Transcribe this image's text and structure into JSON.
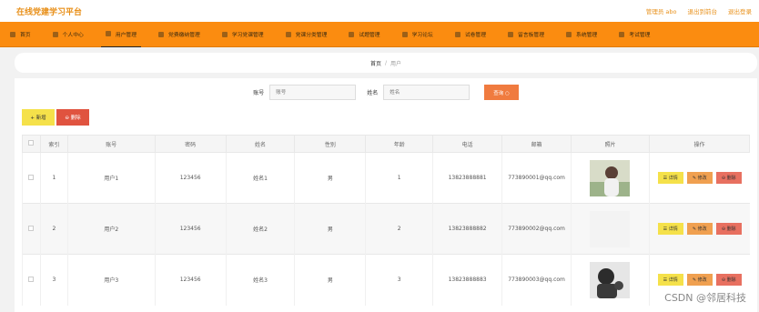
{
  "app": {
    "title": "在线党建学习平台"
  },
  "top_links": {
    "admin": "管理员 abo",
    "backend": "退出到前台",
    "logout": "退出登录"
  },
  "nav": {
    "items": [
      {
        "label": "首页"
      },
      {
        "label": "个人中心"
      },
      {
        "label": "用户管理"
      },
      {
        "label": "党费缴纳管理"
      },
      {
        "label": "学习党课管理"
      },
      {
        "label": "党课分类管理"
      },
      {
        "label": "试题管理"
      },
      {
        "label": "学习论坛"
      },
      {
        "label": "试卷管理"
      },
      {
        "label": "留言板管理"
      },
      {
        "label": "系统管理"
      },
      {
        "label": "考试管理"
      }
    ]
  },
  "breadcrumb": {
    "home": "首页",
    "sep": "/",
    "current": "用户"
  },
  "search": {
    "account_label": "账号",
    "account_placeholder": "账号",
    "name_label": "姓名",
    "name_placeholder": "姓名",
    "button": "查询 ○"
  },
  "actions": {
    "add": "+ 新增",
    "delete": "⊖ 删除"
  },
  "table": {
    "headers": [
      "索引",
      "账号",
      "密码",
      "姓名",
      "性别",
      "年龄",
      "电话",
      "邮箱",
      "照片",
      "操作"
    ],
    "rows": [
      {
        "index": "1",
        "account": "用户1",
        "password": "123456",
        "name": "姓名1",
        "gender": "男",
        "age": "1",
        "phone": "13823888881",
        "email": "773890001@qq.com"
      },
      {
        "index": "2",
        "account": "用户2",
        "password": "123456",
        "name": "姓名2",
        "gender": "男",
        "age": "2",
        "phone": "13823888882",
        "email": "773890002@qq.com"
      },
      {
        "index": "3",
        "account": "用户3",
        "password": "123456",
        "name": "姓名3",
        "gender": "男",
        "age": "3",
        "phone": "13823888883",
        "email": "773890003@qq.com"
      }
    ],
    "ops": {
      "detail": "☰ 详情",
      "edit": "✎ 修改",
      "remove": "⊖ 删除"
    }
  },
  "watermark": "CSDN @邻居科技",
  "colors": {
    "nav_bg": "#fb8c10",
    "brand": "#e8901a",
    "search_btn": "#f07b3f",
    "add_btn": "#f5e14a",
    "del_btn": "#e0533f"
  }
}
